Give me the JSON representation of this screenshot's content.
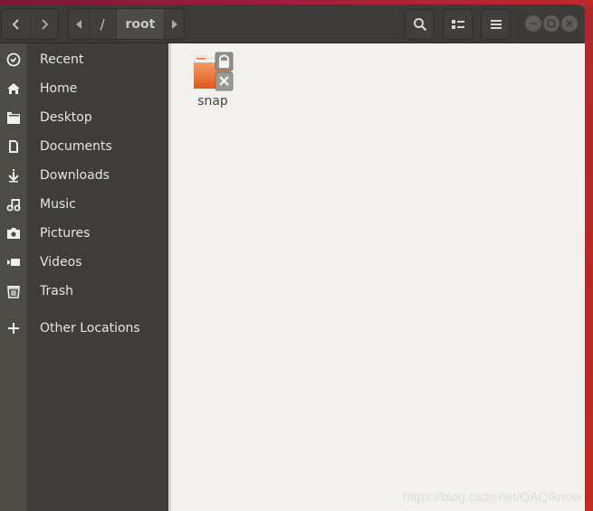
{
  "headerbar": {
    "back_icon": "chevron-left-icon",
    "forward_icon": "chevron-right-icon",
    "path": {
      "left_arrow_icon": "triangle-left-icon",
      "segments": [
        "/",
        "root"
      ],
      "active_segment": "root",
      "right_arrow_icon": "triangle-right-icon"
    },
    "search_icon": "search-icon",
    "view_icon": "list-view-icon",
    "menu_icon": "hamburger-menu-icon",
    "window_controls": [
      "minimize",
      "maximize",
      "close"
    ]
  },
  "sidebar": {
    "items": [
      {
        "label": "Recent",
        "icon": "clock-icon"
      },
      {
        "label": "Home",
        "icon": "home-icon"
      },
      {
        "label": "Desktop",
        "icon": "folder-icon"
      },
      {
        "label": "Documents",
        "icon": "document-icon"
      },
      {
        "label": "Downloads",
        "icon": "download-icon"
      },
      {
        "label": "Music",
        "icon": "music-icon"
      },
      {
        "label": "Pictures",
        "icon": "camera-icon"
      },
      {
        "label": "Videos",
        "icon": "video-icon"
      },
      {
        "label": "Trash",
        "icon": "trash-icon"
      },
      {
        "label": "Other Locations",
        "icon": "plus-icon"
      }
    ]
  },
  "content": {
    "files": [
      {
        "name": "snap",
        "icon": "folder-locked-icon",
        "emblems": [
          "lock",
          "unreadable-x"
        ]
      }
    ]
  },
  "watermark": "https://blog.csdn.net/QAQIknow",
  "colors": {
    "headerbar": "#3c3b37",
    "sidebar": "#3e3d39",
    "sidebar_rail": "#4c4b45",
    "content_bg": "#f2f1f0",
    "folder_orange": "#e9733a",
    "desktop_bg": "#b0262c"
  }
}
